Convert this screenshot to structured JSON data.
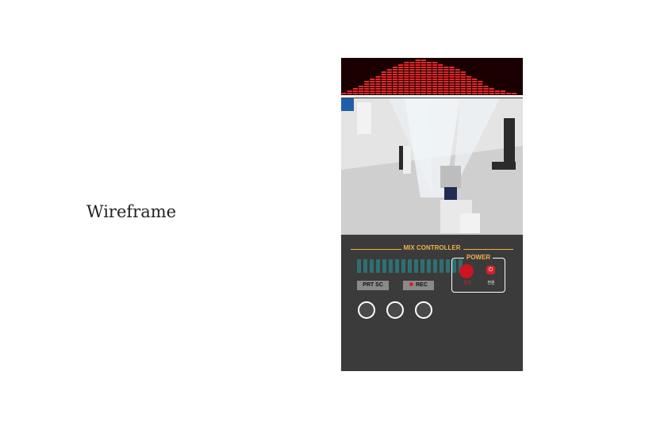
{
  "page": {
    "label": "Wireframe"
  },
  "mix_controller": {
    "title": "MIX CONTROLLER",
    "buttons": {
      "print_screen": "PRT SC",
      "record": "REC"
    },
    "power": {
      "title": "POWER",
      "primary_label": "활성",
      "secondary_label": "전원",
      "power_glyph": "⏻"
    },
    "knob_count": 3,
    "meter_segment_count": 17
  },
  "colors": {
    "accent": "#f0b24a",
    "record": "#d6202a",
    "meter": "#2f6f72",
    "panel": "#3b3b3b",
    "equalizer": "#e8282b",
    "tag": "#1f5fa8"
  },
  "icons": [
    "equalizer-visualizer",
    "record-dot-icon",
    "power-icon"
  ]
}
